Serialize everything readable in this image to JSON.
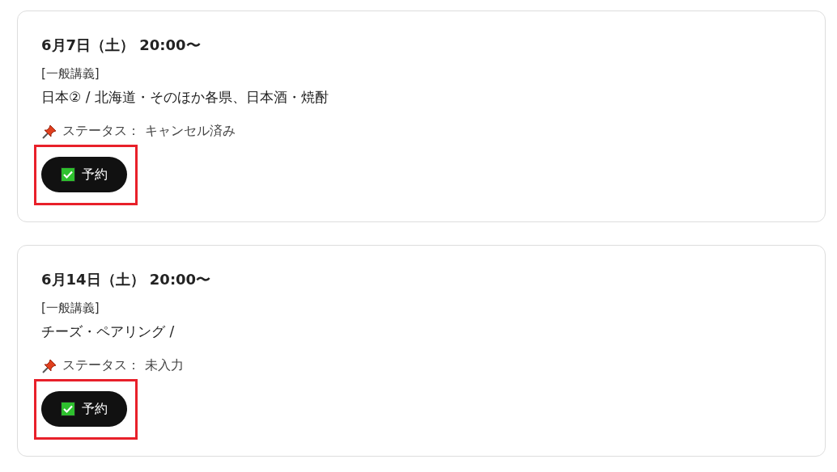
{
  "events": [
    {
      "date": "6月7日（土） 20:00〜",
      "category": "[一般講義]",
      "description": "日本② / 北海道・そのほか各県、日本酒・焼酎",
      "status_label": "ステータス：",
      "status": "キャンセル済み",
      "button": "予約",
      "highlighted": true
    },
    {
      "date": "6月14日（土） 20:00〜",
      "category": "[一般講義]",
      "description": "チーズ・ペアリング /",
      "status_label": "ステータス：",
      "status": "未入力",
      "button": "予約",
      "highlighted": true
    }
  ]
}
